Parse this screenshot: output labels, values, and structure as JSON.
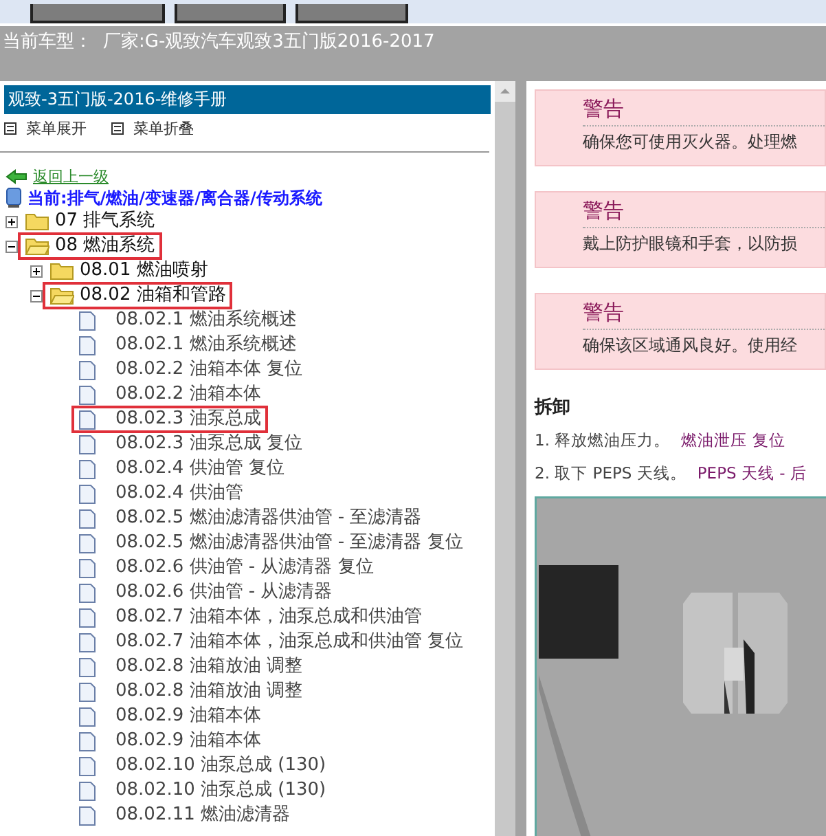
{
  "vehicle_bar": {
    "label": "当前车型：",
    "value": "厂家:G-观致汽车观致3五门版2016-2017"
  },
  "manual": {
    "title": "观致-3五门版-2016-维修手册",
    "menu_actions": [
      {
        "label": "菜单展开"
      },
      {
        "label": "菜单折叠"
      }
    ],
    "back_link": "返回上一级",
    "current_path": "当前:排气/燃油/变速器/离合器/传动系统",
    "tree": [
      {
        "label": "07 排气系统",
        "kind": "folder",
        "expanded": false,
        "highlighted": false
      },
      {
        "label": "08 燃油系统",
        "kind": "folder",
        "expanded": true,
        "highlighted": true,
        "children": [
          {
            "label": "08.01 燃油喷射",
            "kind": "folder",
            "expanded": false,
            "highlighted": false
          },
          {
            "label": "08.02 油箱和管路",
            "kind": "folder",
            "expanded": true,
            "highlighted": true,
            "children": [
              {
                "label": "08.02.1 燃油系统概述",
                "kind": "page",
                "highlighted": false
              },
              {
                "label": "08.02.1 燃油系统概述",
                "kind": "page",
                "highlighted": false
              },
              {
                "label": "08.02.2 油箱本体 复位",
                "kind": "page",
                "highlighted": false
              },
              {
                "label": "08.02.2 油箱本体",
                "kind": "page",
                "highlighted": false
              },
              {
                "label": "08.02.3 油泵总成",
                "kind": "page",
                "highlighted": true
              },
              {
                "label": "08.02.3 油泵总成 复位",
                "kind": "page",
                "highlighted": false
              },
              {
                "label": "08.02.4 供油管 复位",
                "kind": "page",
                "highlighted": false
              },
              {
                "label": "08.02.4 供油管",
                "kind": "page",
                "highlighted": false
              },
              {
                "label": "08.02.5 燃油滤清器供油管 - 至滤清器",
                "kind": "page",
                "highlighted": false
              },
              {
                "label": "08.02.5 燃油滤清器供油管 - 至滤清器 复位",
                "kind": "page",
                "highlighted": false
              },
              {
                "label": "08.02.6 供油管 - 从滤清器 复位",
                "kind": "page",
                "highlighted": false
              },
              {
                "label": "08.02.6 供油管 - 从滤清器",
                "kind": "page",
                "highlighted": false
              },
              {
                "label": "08.02.7 油箱本体，油泵总成和供油管",
                "kind": "page",
                "highlighted": false
              },
              {
                "label": "08.02.7 油箱本体，油泵总成和供油管 复位",
                "kind": "page",
                "highlighted": false
              },
              {
                "label": "08.02.8 油箱放油 调整",
                "kind": "page",
                "highlighted": false
              },
              {
                "label": "08.02.8 油箱放油 调整",
                "kind": "page",
                "highlighted": false
              },
              {
                "label": "08.02.9 油箱本体",
                "kind": "page",
                "highlighted": false
              },
              {
                "label": "08.02.9 油箱本体",
                "kind": "page",
                "highlighted": false
              },
              {
                "label": "08.02.10 油泵总成 (130)",
                "kind": "page",
                "highlighted": false
              },
              {
                "label": "08.02.10 油泵总成 (130)",
                "kind": "page",
                "highlighted": false
              },
              {
                "label": "08.02.11 燃油滤清器",
                "kind": "page",
                "highlighted": false
              }
            ]
          }
        ]
      }
    ]
  },
  "content": {
    "warnings": [
      {
        "title": "警告",
        "text": "确保您可使用灭火器。处理燃"
      },
      {
        "title": "警告",
        "text": "戴上防护眼镜和手套，以防损"
      },
      {
        "title": "警告",
        "text": "确保该区域通风良好。使用经"
      }
    ],
    "section_heading": "拆卸",
    "steps": [
      {
        "text": "1. 释放燃油压力。",
        "link": "燃油泄压 复位"
      },
      {
        "text": "2. 取下 PEPS 天线。",
        "link": "PEPS 天线 - 后"
      }
    ]
  }
}
